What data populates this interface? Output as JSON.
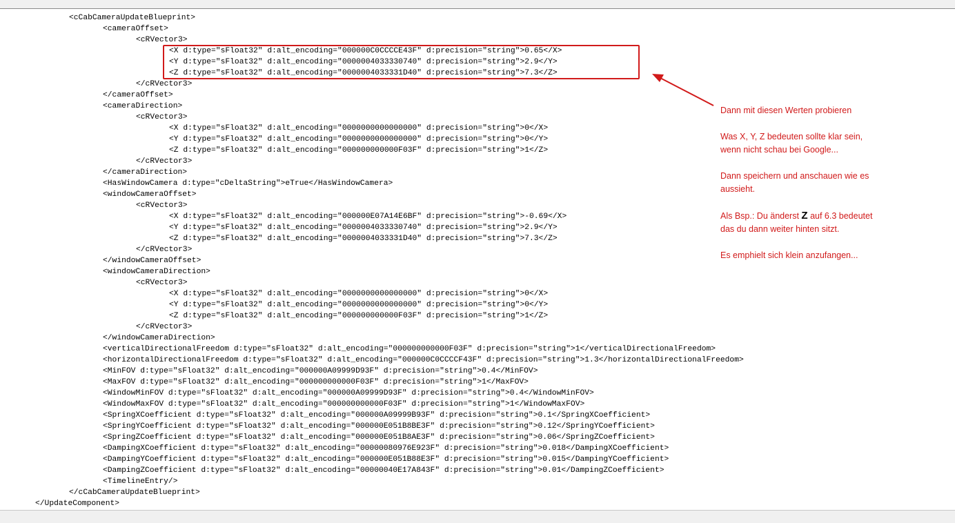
{
  "editor": {
    "lines": [
      "<cCabCameraUpdateBlueprint>",
      "<cameraOffset>",
      "<cRVector3>",
      "<X d:type=\"sFloat32\" d:alt_encoding=\"000000C0CCCCE43F\" d:precision=\"string\">0.65</X>",
      "<Y d:type=\"sFloat32\" d:alt_encoding=\"0000004033330740\" d:precision=\"string\">2.9</Y>",
      "<Z d:type=\"sFloat32\" d:alt_encoding=\"0000004033331D40\" d:precision=\"string\">7.3</Z>",
      "</cRVector3>",
      "</cameraOffset>",
      "<cameraDirection>",
      "<cRVector3>",
      "<X d:type=\"sFloat32\" d:alt_encoding=\"0000000000000000\" d:precision=\"string\">0</X>",
      "<Y d:type=\"sFloat32\" d:alt_encoding=\"0000000000000000\" d:precision=\"string\">0</Y>",
      "<Z d:type=\"sFloat32\" d:alt_encoding=\"000000000000F03F\" d:precision=\"string\">1</Z>",
      "</cRVector3>",
      "</cameraDirection>",
      "<HasWindowCamera d:type=\"cDeltaString\">eTrue</HasWindowCamera>",
      "<windowCameraOffset>",
      "<cRVector3>",
      "<X d:type=\"sFloat32\" d:alt_encoding=\"000000E07A14E6BF\" d:precision=\"string\">-0.69</X>",
      "<Y d:type=\"sFloat32\" d:alt_encoding=\"0000004033330740\" d:precision=\"string\">2.9</Y>",
      "<Z d:type=\"sFloat32\" d:alt_encoding=\"0000004033331D40\" d:precision=\"string\">7.3</Z>",
      "</cRVector3>",
      "</windowCameraOffset>",
      "<windowCameraDirection>",
      "<cRVector3>",
      "<X d:type=\"sFloat32\" d:alt_encoding=\"0000000000000000\" d:precision=\"string\">0</X>",
      "<Y d:type=\"sFloat32\" d:alt_encoding=\"0000000000000000\" d:precision=\"string\">0</Y>",
      "<Z d:type=\"sFloat32\" d:alt_encoding=\"000000000000F03F\" d:precision=\"string\">1</Z>",
      "</cRVector3>",
      "</windowCameraDirection>",
      "<verticalDirectionalFreedom d:type=\"sFloat32\" d:alt_encoding=\"000000000000F03F\" d:precision=\"string\">1</verticalDirectionalFreedom>",
      "<horizontalDirectionalFreedom d:type=\"sFloat32\" d:alt_encoding=\"000000C0CCCCF43F\" d:precision=\"string\">1.3</horizontalDirectionalFreedom>",
      "<MinFOV d:type=\"sFloat32\" d:alt_encoding=\"000000A09999D93F\" d:precision=\"string\">0.4</MinFOV>",
      "<MaxFOV d:type=\"sFloat32\" d:alt_encoding=\"000000000000F03F\" d:precision=\"string\">1</MaxFOV>",
      "<WindowMinFOV d:type=\"sFloat32\" d:alt_encoding=\"000000A09999D93F\" d:precision=\"string\">0.4</WindowMinFOV>",
      "<WindowMaxFOV d:type=\"sFloat32\" d:alt_encoding=\"000000000000F03F\" d:precision=\"string\">1</WindowMaxFOV>",
      "<SpringXCoefficient d:type=\"sFloat32\" d:alt_encoding=\"000000A09999B93F\" d:precision=\"string\">0.1</SpringXCoefficient>",
      "<SpringYCoefficient d:type=\"sFloat32\" d:alt_encoding=\"000000E051B8BE3F\" d:precision=\"string\">0.12</SpringYCoefficient>",
      "<SpringZCoefficient d:type=\"sFloat32\" d:alt_encoding=\"000000E051B8AE3F\" d:precision=\"string\">0.06</SpringZCoefficient>",
      "<DampingXCoefficient d:type=\"sFloat32\" d:alt_encoding=\"00000080976E923F\" d:precision=\"string\">0.018</DampingXCoefficient>",
      "<DampingYCoefficient d:type=\"sFloat32\" d:alt_encoding=\"000000E051B88E3F\" d:precision=\"string\">0.015</DampingYCoefficient>",
      "<DampingZCoefficient d:type=\"sFloat32\" d:alt_encoding=\"00000040E17A843F\" d:precision=\"string\">0.01</DampingZCoefficient>",
      "<TimelineEntry/>",
      "</cCabCameraUpdateBlueprint>",
      "</UpdateComponent>"
    ]
  },
  "annotation": {
    "line1": "Dann mit diesen Werten probieren",
    "line2": "Was X, Y, Z bedeuten sollte klar sein,",
    "line3": "wenn nicht schau bei Google...",
    "line4": "Dann speichern und anschauen wie es",
    "line5": "aussieht.",
    "line6_before": "Als Bsp.: Du änderst ",
    "line6_bold": "Z",
    "line6_after": " auf 6.3 bedeutet",
    "line7": "das du dann weiter hinten sitzt.",
    "line8": "Es emphielt sich klein anzufangen..."
  },
  "colors": {
    "annotation": "#d11a1a",
    "highlight_border": "#d11a1a"
  }
}
